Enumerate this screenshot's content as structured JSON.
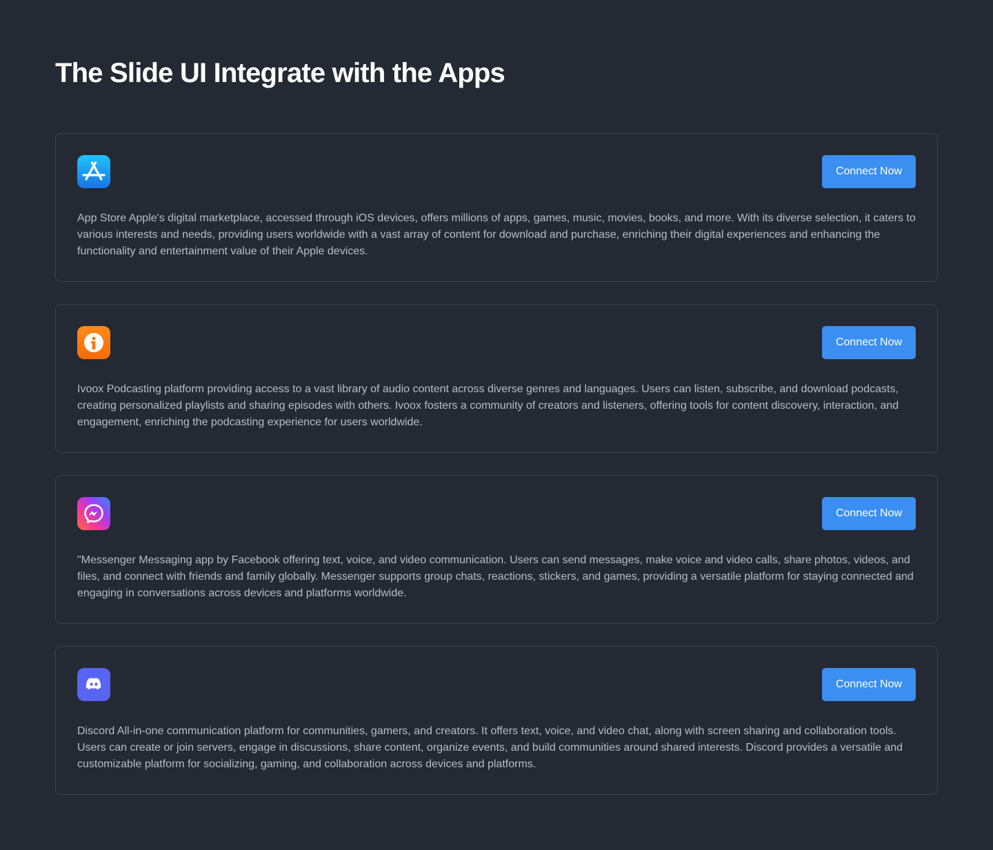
{
  "page": {
    "title": "The Slide UI Integrate with the Apps"
  },
  "colors": {
    "background": "#232a33",
    "card_border": "#3b434e",
    "button": "#3b8ff0",
    "description_text": "#b8bec7"
  },
  "apps": [
    {
      "icon": "app-store-icon",
      "description": "App Store Apple's digital marketplace, accessed through iOS devices, offers millions of apps, games, music, movies, books, and more. With its diverse selection, it caters to various interests and needs, providing users worldwide with a vast array of content for download and purchase, enriching their digital experiences and enhancing the functionality and entertainment value of their Apple devices.",
      "button_label": "Connect Now"
    },
    {
      "icon": "ivoox-icon",
      "description": "Ivoox Podcasting platform providing access to a vast library of audio content across diverse genres and languages. Users can listen, subscribe, and download podcasts, creating personalized playlists and sharing episodes with others. Ivoox fosters a community of creators and listeners, offering tools for content discovery, interaction, and engagement, enriching the podcasting experience for users worldwide.",
      "button_label": "Connect Now"
    },
    {
      "icon": "messenger-icon",
      "description": "\"Messenger Messaging app by Facebook offering text, voice, and video communication. Users can send messages, make voice and video calls, share photos, videos, and files, and connect with friends and family globally. Messenger supports group chats, reactions, stickers, and games, providing a versatile platform for staying connected and engaging in conversations across devices and platforms worldwide.",
      "button_label": "Connect Now"
    },
    {
      "icon": "discord-icon",
      "description": "Discord All-in-one communication platform for communities, gamers, and creators. It offers text, voice, and video chat, along with screen sharing and collaboration tools. Users can create or join servers, engage in discussions, share content, organize events, and build communities around shared interests. Discord provides a versatile and customizable platform for socializing, gaming, and collaboration across devices and platforms.",
      "button_label": "Connect Now"
    }
  ]
}
